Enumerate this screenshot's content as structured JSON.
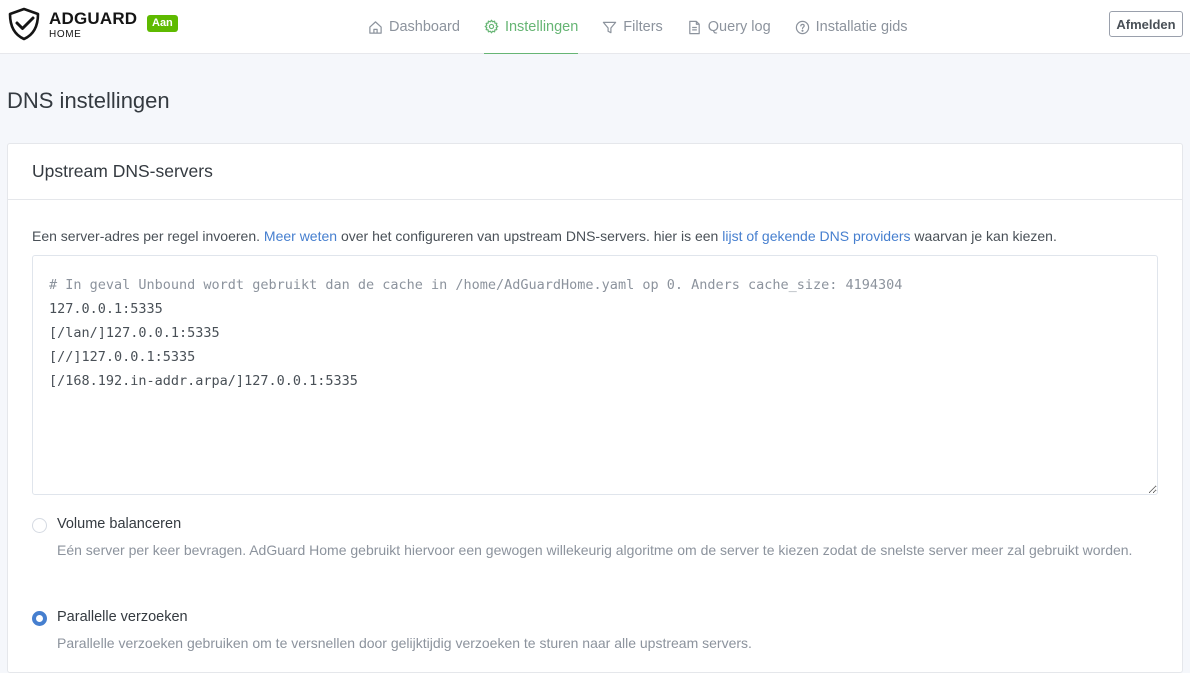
{
  "brand": {
    "name": "ADGUARD",
    "sub": "HOME",
    "status_badge": "Aan"
  },
  "nav": [
    {
      "label": "Dashboard",
      "icon": "home-icon"
    },
    {
      "label": "Instellingen",
      "icon": "gear-icon",
      "active": true
    },
    {
      "label": "Filters",
      "icon": "filter-icon"
    },
    {
      "label": "Query log",
      "icon": "document-icon"
    },
    {
      "label": "Installatie gids",
      "icon": "help-circle-icon"
    }
  ],
  "logout_label": "Afmelden",
  "page_title": "DNS instellingen",
  "upstream": {
    "title": "Upstream DNS-servers",
    "desc_text1": "Een server-adres per regel invoeren. ",
    "desc_link1": "Meer weten",
    "desc_text2": " over het configureren van upstream DNS-servers. hier is een ",
    "desc_link2": "lijst of gekende DNS providers",
    "desc_text3": " waarvan je kan kiezen.",
    "lines": [
      "# In geval Unbound wordt gebruikt dan de cache in /home/AdGuardHome.yaml op 0. Anders cache_size: 4194304",
      "127.0.0.1:5335",
      "[/lan/]127.0.0.1:5335",
      "[//]127.0.0.1:5335",
      "[/168.192.in-addr.arpa/]127.0.0.1:5335"
    ]
  },
  "options": [
    {
      "label": "Volume balanceren",
      "desc": "Eén server per keer bevragen. AdGuard Home gebruikt hiervoor een gewogen willekeurig algoritme om de server te kiezen zodat de snelste server meer zal gebruikt worden.",
      "checked": false
    },
    {
      "label": "Parallelle verzoeken",
      "desc": "Parallelle verzoeken gebruiken om te versnellen door gelijktijdig verzoeken te sturen naar alle upstream servers.",
      "checked": true
    }
  ],
  "colors": {
    "accent_green": "#66b574",
    "badge_green": "#5eba00",
    "link_blue": "#467fcf"
  }
}
